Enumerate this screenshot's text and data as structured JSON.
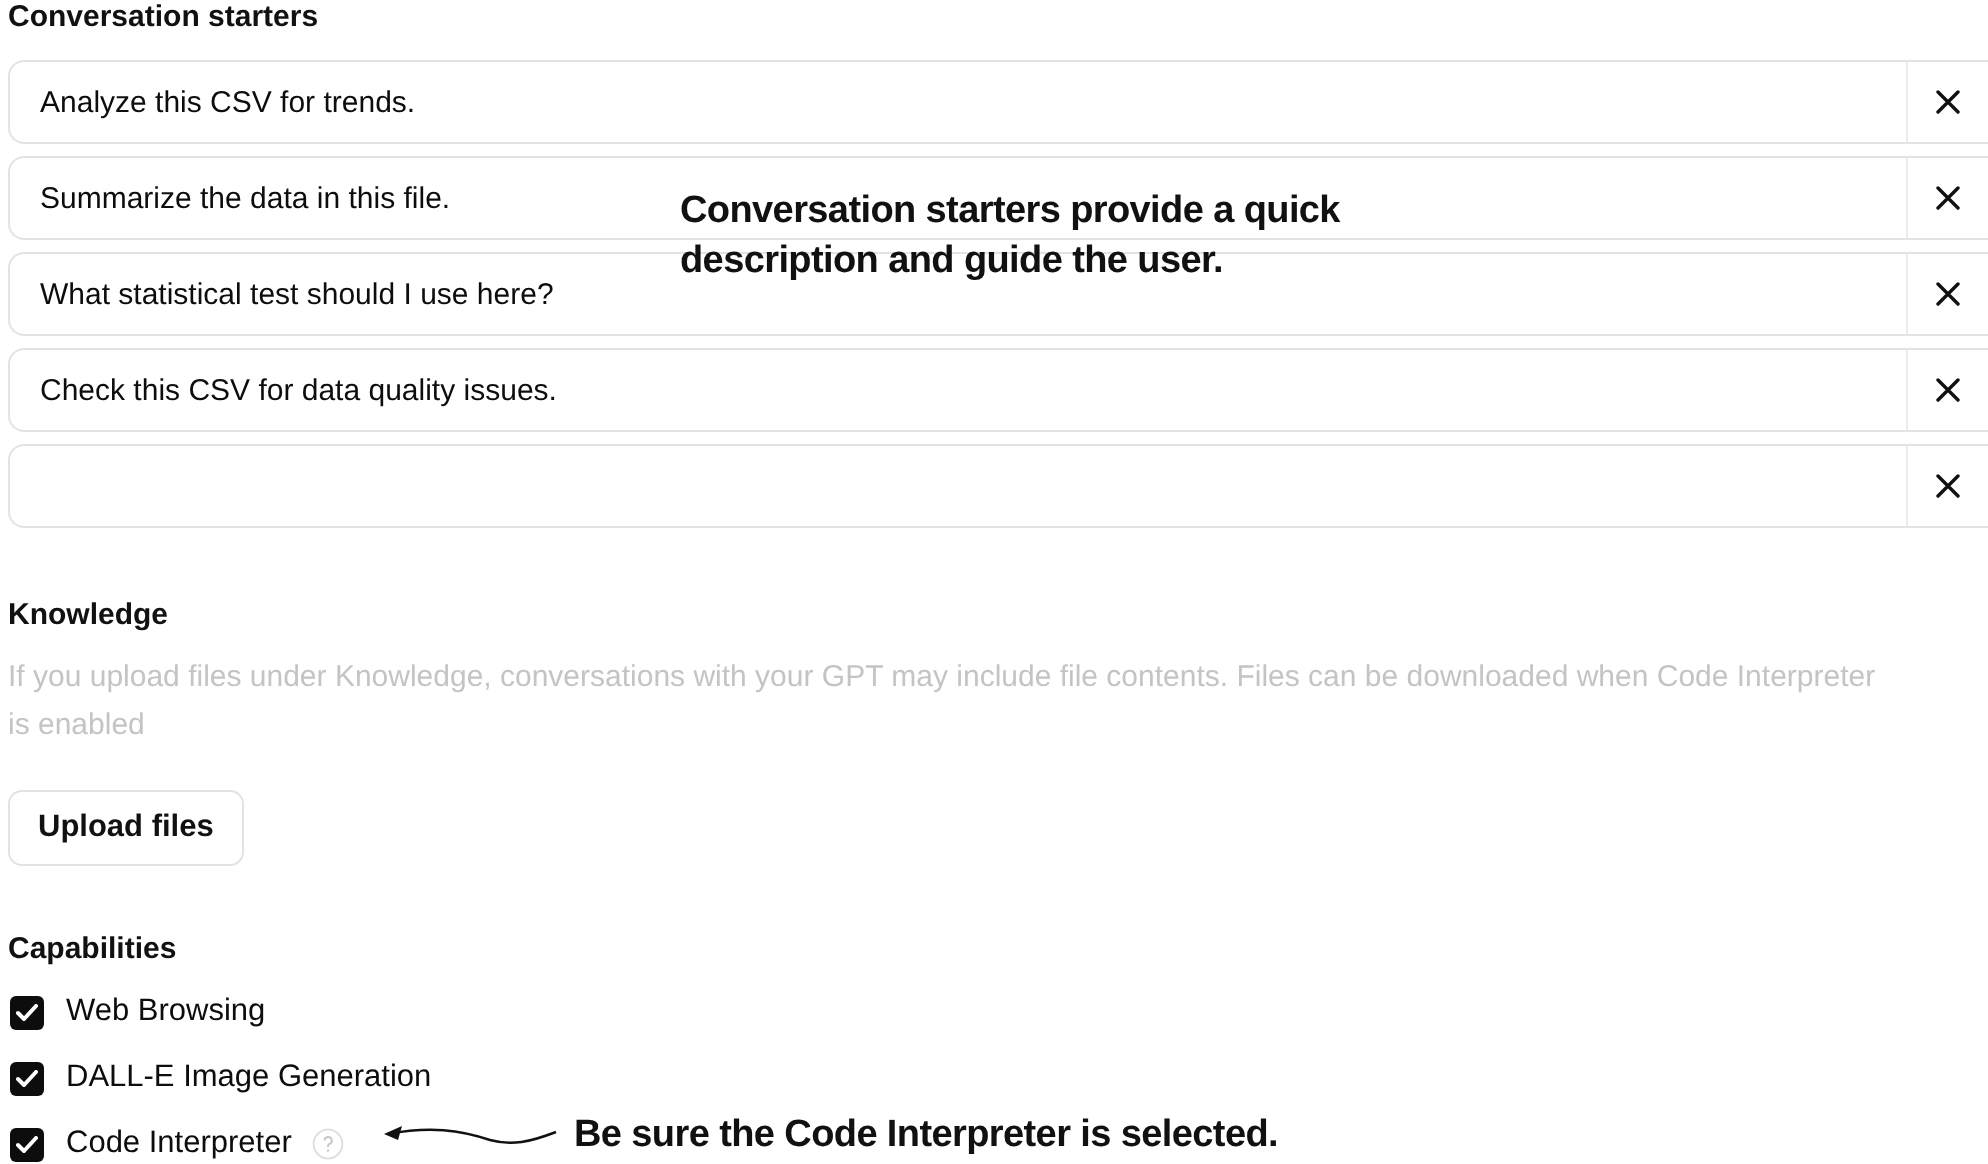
{
  "conversation_starters": {
    "title": "Conversation starters",
    "items": [
      {
        "kind": "filled",
        "text": "Analyze this CSV for trends."
      },
      {
        "kind": "filled",
        "text": "Summarize the data in this file."
      },
      {
        "kind": "filled",
        "text": "What statistical test should I use here?"
      },
      {
        "kind": "filled",
        "text": "Check this CSV for data quality issues."
      },
      {
        "kind": "blank"
      }
    ]
  },
  "knowledge": {
    "title": "Knowledge",
    "description": "If you upload files under Knowledge, conversations with your GPT may include file contents. Files can be downloaded when Code Interpreter is enabled",
    "button": "Upload files"
  },
  "capabilities": {
    "title": "Capabilities",
    "items": [
      {
        "label": "Web Browsing",
        "checked": true,
        "help": false
      },
      {
        "label": "DALL-E Image Generation",
        "checked": true,
        "help": false
      },
      {
        "label": "Code Interpreter",
        "checked": true,
        "help": true
      }
    ]
  },
  "annotations": [
    {
      "kind": "callout",
      "text": "Conversation starters provide a quick description and guide the user."
    },
    {
      "kind": "arrow-callout",
      "text": "Be sure the Code Interpreter is selected."
    }
  ]
}
